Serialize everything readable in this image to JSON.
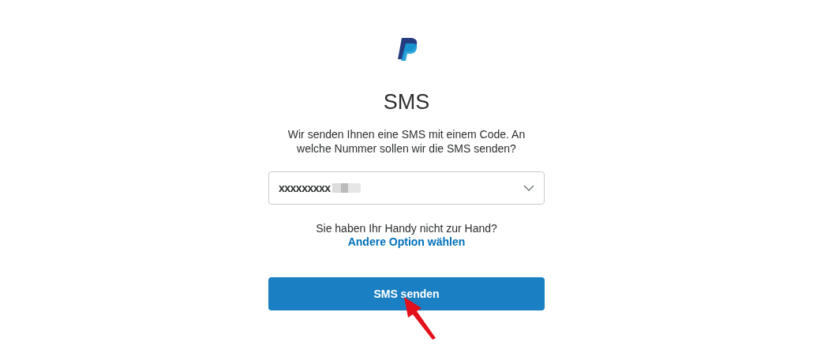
{
  "title": "SMS",
  "description": "Wir senden Ihnen eine SMS mit einem Code. An welche Nummer sollen wir die SMS senden?",
  "phone_select": {
    "value": "xxxxxxxxx",
    "redacted": true
  },
  "help": {
    "text": "Sie haben Ihr Handy nicht zur Hand?",
    "link": "Andere Option wählen"
  },
  "submit_button": {
    "label": "SMS senden"
  },
  "annotation": {
    "kind": "arrow",
    "color": "#e3101b"
  }
}
